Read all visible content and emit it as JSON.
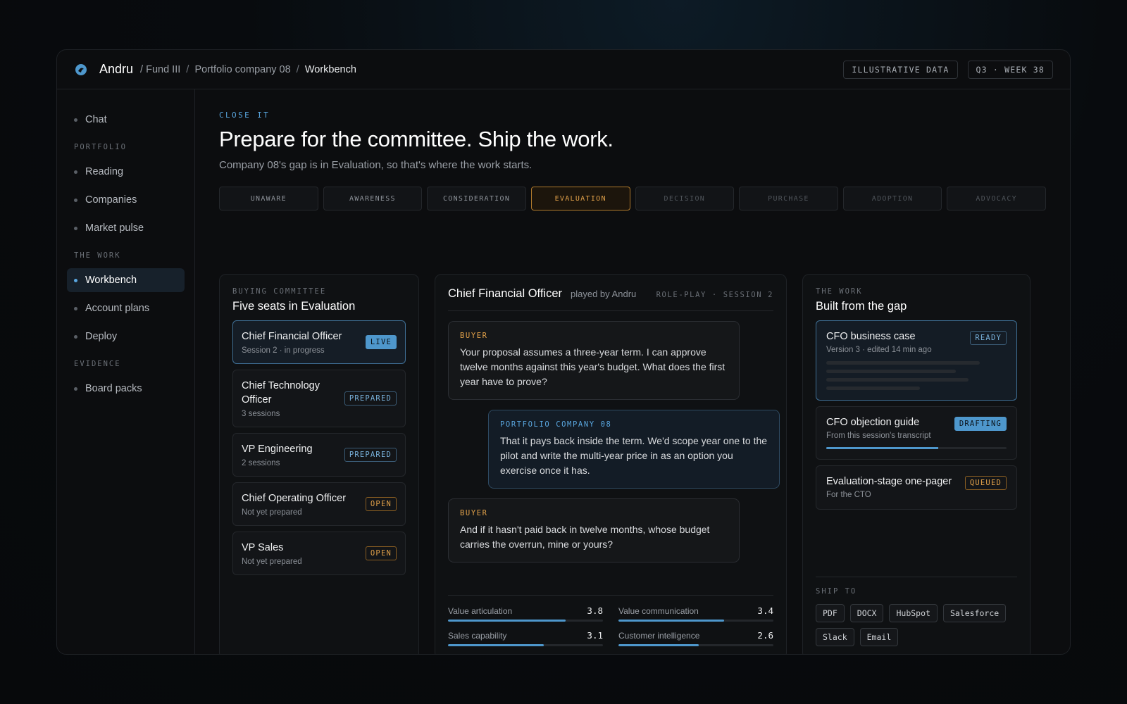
{
  "header": {
    "brand": "Andru",
    "breadcrumbs": [
      "/ Fund III",
      "Portfolio company 08",
      "Workbench"
    ],
    "badges": [
      "ILLUSTRATIVE DATA",
      "Q3 · WEEK 38"
    ]
  },
  "sidebar": {
    "chat": "Chat",
    "sections": [
      {
        "label": "PORTFOLIO",
        "items": [
          "Reading",
          "Companies",
          "Market pulse"
        ]
      },
      {
        "label": "THE WORK",
        "items": [
          "Workbench",
          "Account plans",
          "Deploy"
        ]
      },
      {
        "label": "EVIDENCE",
        "items": [
          "Board packs"
        ]
      }
    ],
    "active_item": "Workbench"
  },
  "main": {
    "eyebrow": "CLOSE IT",
    "title": "Prepare for the committee. Ship the work.",
    "subtitle": "Company 08's gap is in Evaluation, so that's where the work starts.",
    "stages": [
      "UNAWARE",
      "AWARENESS",
      "CONSIDERATION",
      "EVALUATION",
      "DECISION",
      "PURCHASE",
      "ADOPTION",
      "ADVOCACY"
    ],
    "active_stage": "EVALUATION"
  },
  "committee": {
    "eyebrow": "BUYING COMMITTEE",
    "title": "Five seats in Evaluation",
    "seats": [
      {
        "name": "Chief Financial Officer",
        "meta": "Session 2 · in progress",
        "badge": "LIVE"
      },
      {
        "name": "Chief Technology Officer",
        "meta": "3 sessions",
        "badge": "PREPARED"
      },
      {
        "name": "VP Engineering",
        "meta": "2 sessions",
        "badge": "PREPARED"
      },
      {
        "name": "Chief Operating Officer",
        "meta": "Not yet prepared",
        "badge": "OPEN"
      },
      {
        "name": "VP Sales",
        "meta": "Not yet prepared",
        "badge": "OPEN"
      }
    ]
  },
  "roleplay": {
    "title": "Chief Financial Officer",
    "played_by": "played by Andru",
    "session": "ROLE-PLAY · SESSION 2",
    "messages": [
      {
        "role": "BUYER",
        "text": "Your proposal assumes a three-year term. I can approve twelve months against this year's budget. What does the first year have to prove?"
      },
      {
        "role": "PORTFOLIO COMPANY 08",
        "text": "That it pays back inside the term. We'd scope year one to the pilot and write the multi-year price in as an option you exercise once it has."
      },
      {
        "role": "BUYER",
        "text": "And if it hasn't paid back in twelve months, whose budget carries the overrun, mine or yours?"
      }
    ],
    "scores": [
      {
        "label": "Value articulation",
        "value": "3.8",
        "fraction": 0.76
      },
      {
        "label": "Value communication",
        "value": "3.4",
        "fraction": 0.68
      },
      {
        "label": "Sales capability",
        "value": "3.1",
        "fraction": 0.62
      },
      {
        "label": "Customer intelligence",
        "value": "2.6",
        "fraction": 0.52
      }
    ]
  },
  "work": {
    "eyebrow": "THE WORK",
    "title": "Built from the gap",
    "docs": [
      {
        "name": "CFO business case",
        "meta": "Version 3 · edited 14 min ago",
        "badge": "READY"
      },
      {
        "name": "CFO objection guide",
        "meta": "From this session's transcript",
        "badge": "DRAFTING",
        "progress": 0.62
      },
      {
        "name": "Evaluation-stage one-pager",
        "meta": "For the CTO",
        "badge": "QUEUED"
      }
    ],
    "ship_label": "SHIP TO",
    "ship_targets": [
      "PDF",
      "DOCX",
      "HubSpot",
      "Salesforce",
      "Slack",
      "Email"
    ]
  },
  "colors": {
    "accent_blue": "#4e97cc",
    "accent_amber": "#e3a24a",
    "background": "#0c0d0f"
  },
  "icons": {
    "logo": "andru-logo-icon"
  }
}
